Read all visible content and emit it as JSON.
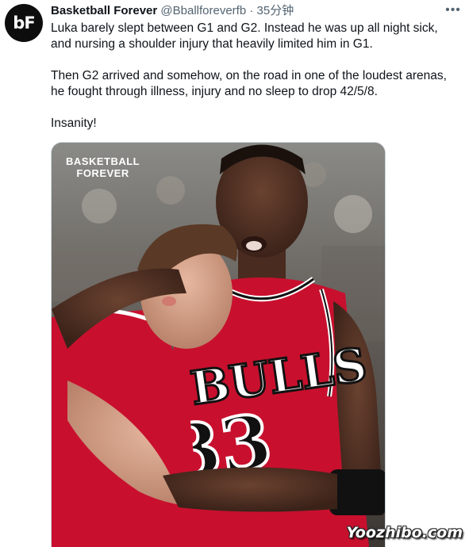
{
  "tweet": {
    "author_name": "Basketball Forever",
    "author_handle": "@Bballforeverfb",
    "separator": "·",
    "timestamp": "35分钟",
    "more_icon": "more-horizontal-icon",
    "avatar_text": "bF",
    "text": "Luka barely slept between G1 and G2. Instead he was up all night sick, and nursing a shoulder injury that heavily limited him in G1.\n\nThen G2 arrived and somehow, on the road in one of the loudest arenas, he fought through illness, injury and no sleep to drop 42/5/8.\n\nInsanity!",
    "media": {
      "brand_line1": "BASKETBALL",
      "brand_line2": "FOREVER",
      "jersey_text": "BULLS",
      "jersey_number": "33"
    }
  },
  "watermark": "Yoozhibo.com",
  "colors": {
    "text": "#0f1419",
    "secondary": "#536471",
    "jersey_red": "#c8102e"
  }
}
